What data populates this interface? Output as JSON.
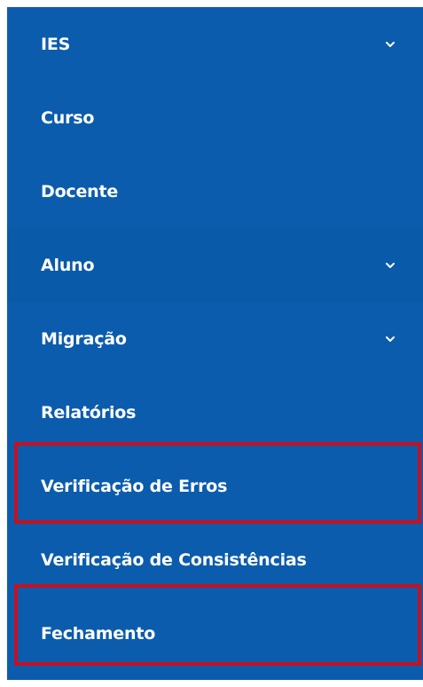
{
  "sidebar": {
    "items": [
      {
        "label": "IES",
        "has_submenu": true,
        "icon": "chevron-down-icon"
      },
      {
        "label": "Curso",
        "has_submenu": false
      },
      {
        "label": "Docente",
        "has_submenu": false
      },
      {
        "label": "Aluno",
        "has_submenu": true,
        "icon": "chevron-down-icon"
      },
      {
        "label": "Migração",
        "has_submenu": true,
        "icon": "chevron-down-icon"
      },
      {
        "label": "Relatórios",
        "has_submenu": false
      },
      {
        "label": "Verificação de Erros",
        "has_submenu": false,
        "highlighted": true
      },
      {
        "label": "Verificação de Consistências",
        "has_submenu": false
      },
      {
        "label": "Fechamento",
        "has_submenu": false,
        "highlighted": true
      }
    ]
  },
  "colors": {
    "sidebar_bg": "#0b5cad",
    "text": "#ffffff",
    "highlight_border": "#c8101e"
  }
}
